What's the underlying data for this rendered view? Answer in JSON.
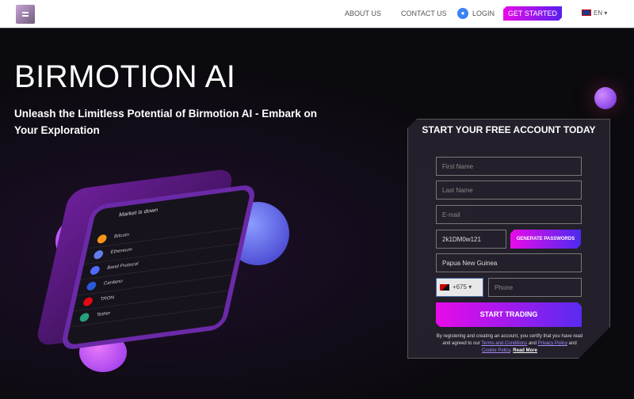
{
  "nav": {
    "about": "ABOUT US",
    "contact": "CONTACT US",
    "login": "LOGIN",
    "get_started": "GET STARTED",
    "language": "EN ▾"
  },
  "hero": {
    "title": "BIRMOTION AI",
    "subtitle": "Unleash the Limitless Potential of Birmotion AI - Embark on Your Exploration"
  },
  "phone": {
    "header": "Market is down",
    "coins": [
      {
        "name": "Bitcoin",
        "color": "#f7931a"
      },
      {
        "name": "Ethereum",
        "color": "#627eea"
      },
      {
        "name": "Band Protocol",
        "color": "#516aff"
      },
      {
        "name": "Cardano",
        "color": "#2a5ada"
      },
      {
        "name": "TRON",
        "color": "#e50914"
      },
      {
        "name": "Tether",
        "color": "#26a17b"
      }
    ]
  },
  "form": {
    "title": "START YOUR FREE ACCOUNT TODAY",
    "first_name_placeholder": "First Name",
    "last_name_placeholder": "Last Name",
    "email_placeholder": "E-mail",
    "password_value": "2k1DM0w121",
    "generate_label": "GENERATE PASSWORDS",
    "country_value": "Papua New Guinea",
    "dial_code": "+675 ▾",
    "phone_placeholder": "Phone",
    "submit_label": "START TRADING",
    "terms": {
      "prefix": "By registering and creating an account, you certify that you have read and agreed to our ",
      "terms_link": "Terms and Conditions",
      "and1": " and ",
      "privacy_link": "Privacy Policy",
      "and2": " and ",
      "cookie_link": "Cookie Policy",
      "dot": ". ",
      "read_more": "Read More"
    }
  },
  "colors": {
    "accent_start": "#e80be8",
    "accent_end": "#5a1ef0"
  }
}
